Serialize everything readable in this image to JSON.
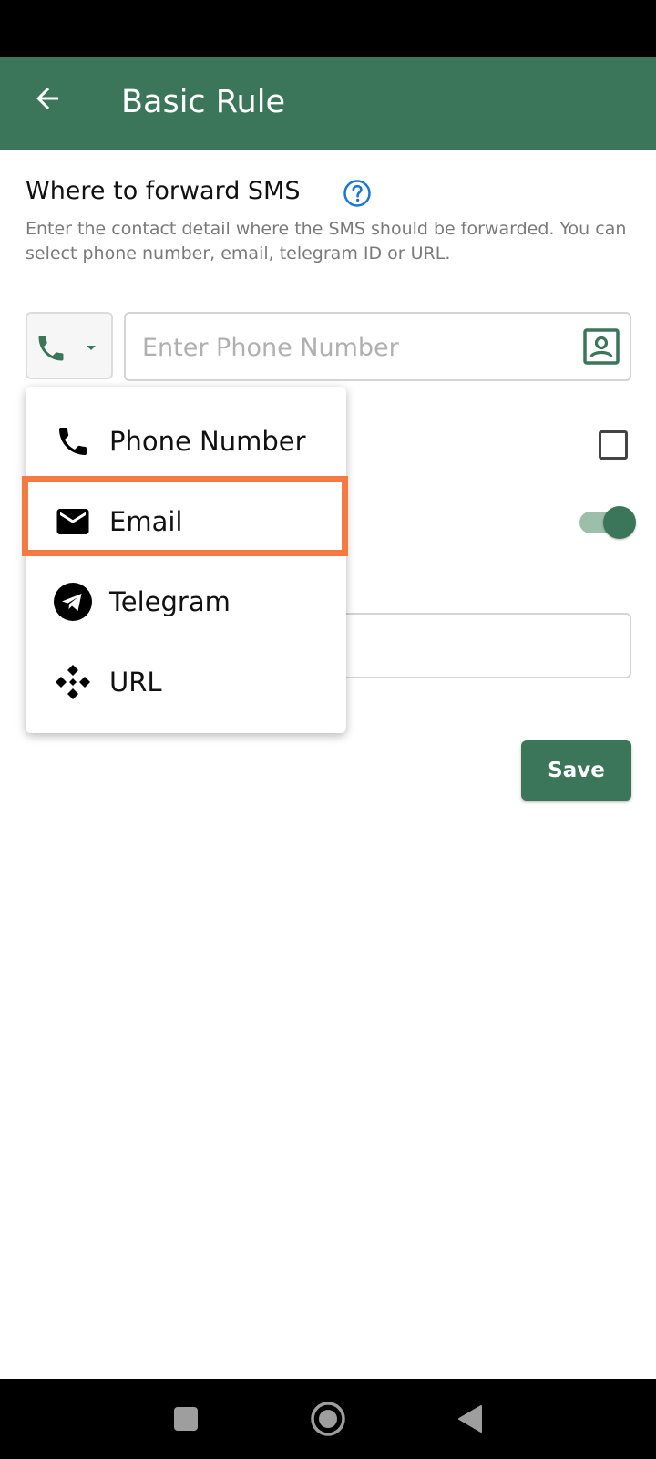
{
  "app_bar": {
    "title": "Basic Rule",
    "back_icon": "arrow-left-icon"
  },
  "section": {
    "title": "Where to forward SMS",
    "help_icon": "question-circle-icon",
    "description": "Enter the contact detail where the SMS should be forwarded. You can select phone number, email, telegram ID or URL."
  },
  "type_select": {
    "selected_icon": "phone-icon",
    "caret_icon": "caret-down-icon"
  },
  "phone_input": {
    "value": "",
    "placeholder": "Enter Phone Number",
    "contact_icon": "contact-picker-icon"
  },
  "options_checkbox": {
    "checked": false
  },
  "toggle": {
    "on": true
  },
  "dropdown": {
    "items": [
      {
        "label": "Phone Number",
        "icon": "phone-icon"
      },
      {
        "label": "Email",
        "icon": "email-icon"
      },
      {
        "label": "Telegram",
        "icon": "telegram-icon"
      },
      {
        "label": "URL",
        "icon": "url-icon"
      }
    ],
    "highlighted": "Email"
  },
  "save_button": {
    "label": "Save"
  },
  "colors": {
    "primary": "#3b765a",
    "highlight": "#f47a42",
    "help_blue": "#1976d2"
  },
  "nav_bar": {
    "icons": [
      "recents-square-icon",
      "home-circle-icon",
      "back-triangle-icon"
    ]
  }
}
